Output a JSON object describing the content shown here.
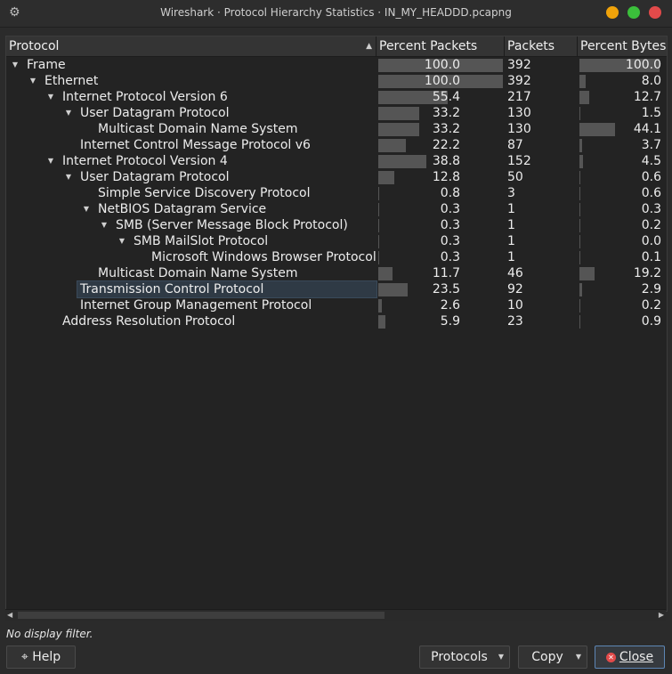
{
  "window": {
    "title": "Wireshark · Protocol Hierarchy Statistics · IN_MY_HEADDD.pcapng",
    "settings_icon": "gear-icon"
  },
  "columns": [
    "Protocol",
    "Percent Packets",
    "Packets",
    "Percent Bytes"
  ],
  "rows": [
    {
      "name": "Frame",
      "depth": 0,
      "expanded": true,
      "pct_packets": "100.0",
      "packets": "392",
      "pct_bytes": "100.0",
      "pp": 1.0,
      "pb": 1.0
    },
    {
      "name": "Ethernet",
      "depth": 1,
      "expanded": true,
      "pct_packets": "100.0",
      "packets": "392",
      "pct_bytes": "8.0",
      "pp": 1.0,
      "pb": 0.08
    },
    {
      "name": "Internet Protocol Version 6",
      "depth": 2,
      "expanded": true,
      "pct_packets": "55.4",
      "packets": "217",
      "pct_bytes": "12.7",
      "pp": 0.554,
      "pb": 0.127
    },
    {
      "name": "User Datagram Protocol",
      "depth": 3,
      "expanded": true,
      "pct_packets": "33.2",
      "packets": "130",
      "pct_bytes": "1.5",
      "pp": 0.332,
      "pb": 0.015
    },
    {
      "name": "Multicast Domain Name System",
      "depth": 4,
      "expanded": null,
      "pct_packets": "33.2",
      "packets": "130",
      "pct_bytes": "44.1",
      "pp": 0.332,
      "pb": 0.441
    },
    {
      "name": "Internet Control Message Protocol v6",
      "depth": 3,
      "expanded": null,
      "pct_packets": "22.2",
      "packets": "87",
      "pct_bytes": "3.7",
      "pp": 0.222,
      "pb": 0.037
    },
    {
      "name": "Internet Protocol Version 4",
      "depth": 2,
      "expanded": true,
      "pct_packets": "38.8",
      "packets": "152",
      "pct_bytes": "4.5",
      "pp": 0.388,
      "pb": 0.045
    },
    {
      "name": "User Datagram Protocol",
      "depth": 3,
      "expanded": true,
      "pct_packets": "12.8",
      "packets": "50",
      "pct_bytes": "0.6",
      "pp": 0.128,
      "pb": 0.006
    },
    {
      "name": "Simple Service Discovery Protocol",
      "depth": 4,
      "expanded": null,
      "pct_packets": "0.8",
      "packets": "3",
      "pct_bytes": "0.6",
      "pp": 0.008,
      "pb": 0.006
    },
    {
      "name": "NetBIOS Datagram Service",
      "depth": 4,
      "expanded": true,
      "pct_packets": "0.3",
      "packets": "1",
      "pct_bytes": "0.3",
      "pp": 0.003,
      "pb": 0.003
    },
    {
      "name": "SMB (Server Message Block Protocol)",
      "depth": 5,
      "expanded": true,
      "pct_packets": "0.3",
      "packets": "1",
      "pct_bytes": "0.2",
      "pp": 0.003,
      "pb": 0.002
    },
    {
      "name": "SMB MailSlot Protocol",
      "depth": 6,
      "expanded": true,
      "pct_packets": "0.3",
      "packets": "1",
      "pct_bytes": "0.0",
      "pp": 0.003,
      "pb": 0.0
    },
    {
      "name": "Microsoft Windows Browser Protocol",
      "depth": 7,
      "expanded": null,
      "pct_packets": "0.3",
      "packets": "1",
      "pct_bytes": "0.1",
      "pp": 0.003,
      "pb": 0.001
    },
    {
      "name": "Multicast Domain Name System",
      "depth": 4,
      "expanded": null,
      "pct_packets": "11.7",
      "packets": "46",
      "pct_bytes": "19.2",
      "pp": 0.117,
      "pb": 0.192
    },
    {
      "name": "Transmission Control Protocol",
      "depth": 3,
      "expanded": null,
      "pct_packets": "23.5",
      "packets": "92",
      "pct_bytes": "2.9",
      "pp": 0.235,
      "pb": 0.029,
      "selected": true
    },
    {
      "name": "Internet Group Management Protocol",
      "depth": 3,
      "expanded": null,
      "pct_packets": "2.6",
      "packets": "10",
      "pct_bytes": "0.2",
      "pp": 0.026,
      "pb": 0.002
    },
    {
      "name": "Address Resolution Protocol",
      "depth": 2,
      "expanded": null,
      "pct_packets": "5.9",
      "packets": "23",
      "pct_bytes": "0.9",
      "pp": 0.059,
      "pb": 0.009
    }
  ],
  "status": {
    "filter_text": "No display filter."
  },
  "buttons": {
    "help": "Help",
    "protocols": "Protocols",
    "copy": "Copy",
    "close": "Close"
  },
  "colors": {
    "accent": "#5d86b5",
    "bar": "#555555",
    "selection": "#2f3a45"
  }
}
